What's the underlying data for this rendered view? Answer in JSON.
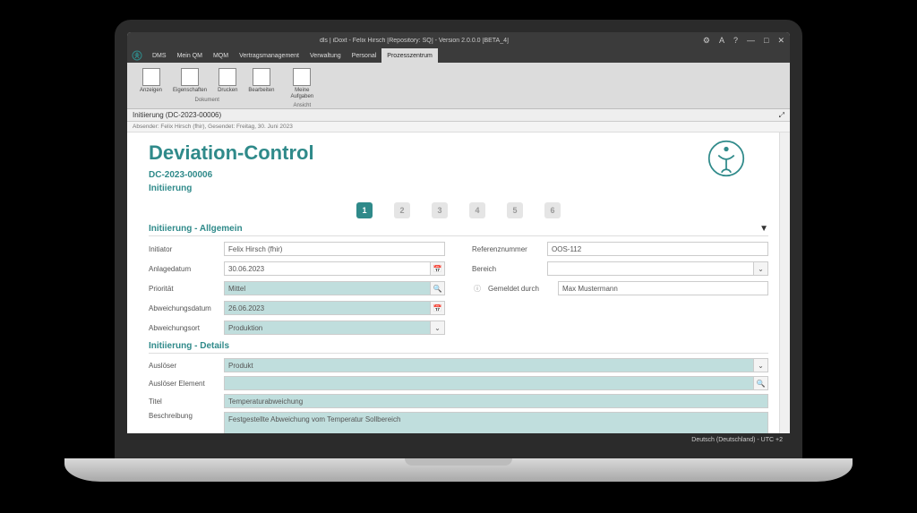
{
  "titlebar": {
    "title": "dls | iDoxt - Felix Hirsch [Repository: SQ] - Version 2.0.0.0 [BETA_4]"
  },
  "wctrl": {
    "settings": "⚙",
    "font": "A",
    "help": "?",
    "min": "—",
    "max": "□",
    "close": "✕"
  },
  "menu": {
    "items": [
      "DMS",
      "Mein QM",
      "MQM",
      "Vertragsmanagement",
      "Verwaltung",
      "Personal",
      "Prozesszentrum"
    ],
    "active_index": 6
  },
  "ribbon": {
    "group1": {
      "label": "Dokument",
      "items": [
        "Anzeigen",
        "Eigenschaften",
        "Drucken",
        "Bearbeiten"
      ]
    },
    "group2": {
      "label": "Ansicht",
      "items": [
        {
          "line1": "Meine",
          "line2": "Aufgaben"
        }
      ]
    }
  },
  "subheader": {
    "text": "Initiierung (DC-2023-00006)"
  },
  "meta": {
    "text": "Absender: Felix Hirsch (fhir), Gesendet: Freitag, 30. Juni 2023"
  },
  "doc": {
    "title": "Deviation-Control",
    "id": "DC-2023-00006",
    "stage": "Initiierung"
  },
  "steps": {
    "count": 6,
    "active": 1
  },
  "section1": {
    "title": "Initiierung - Allgemein",
    "left": {
      "initiator": {
        "label": "Initiator",
        "value": "Felix Hirsch (fhir)"
      },
      "anlagedatum": {
        "label": "Anlagedatum",
        "value": "30.06.2023"
      },
      "prioritaet": {
        "label": "Priorität",
        "value": "Mittel"
      },
      "abweichungsdatum": {
        "label": "Abweichungsdatum",
        "value": "26.06.2023"
      },
      "abweichungsort": {
        "label": "Abweichungsort",
        "value": "Produktion"
      }
    },
    "right": {
      "referenznummer": {
        "label": "Referenznummer",
        "value": "OOS-112"
      },
      "bereich": {
        "label": "Bereich",
        "value": ""
      },
      "gemeldet": {
        "label": "Gemeldet durch",
        "value": "Max Mustermann"
      }
    }
  },
  "section2": {
    "title": "Initiierung - Details",
    "ausloeser": {
      "label": "Auslöser",
      "value": "Produkt"
    },
    "ausloeser_element": {
      "label": "Auslöser Element",
      "value": ""
    },
    "titel": {
      "label": "Titel",
      "value": "Temperaturabweichung"
    },
    "beschreibung": {
      "label": "Beschreibung",
      "value": "Festgestellte Abweichung vom Temperatur Sollbereich"
    }
  },
  "statusbar": {
    "text": "Deutsch (Deutschland) - UTC +2"
  },
  "icons": {
    "calendar": "📅",
    "search": "🔍",
    "dropdown": "⌄",
    "info": "ⓘ",
    "collapse": "▼"
  }
}
